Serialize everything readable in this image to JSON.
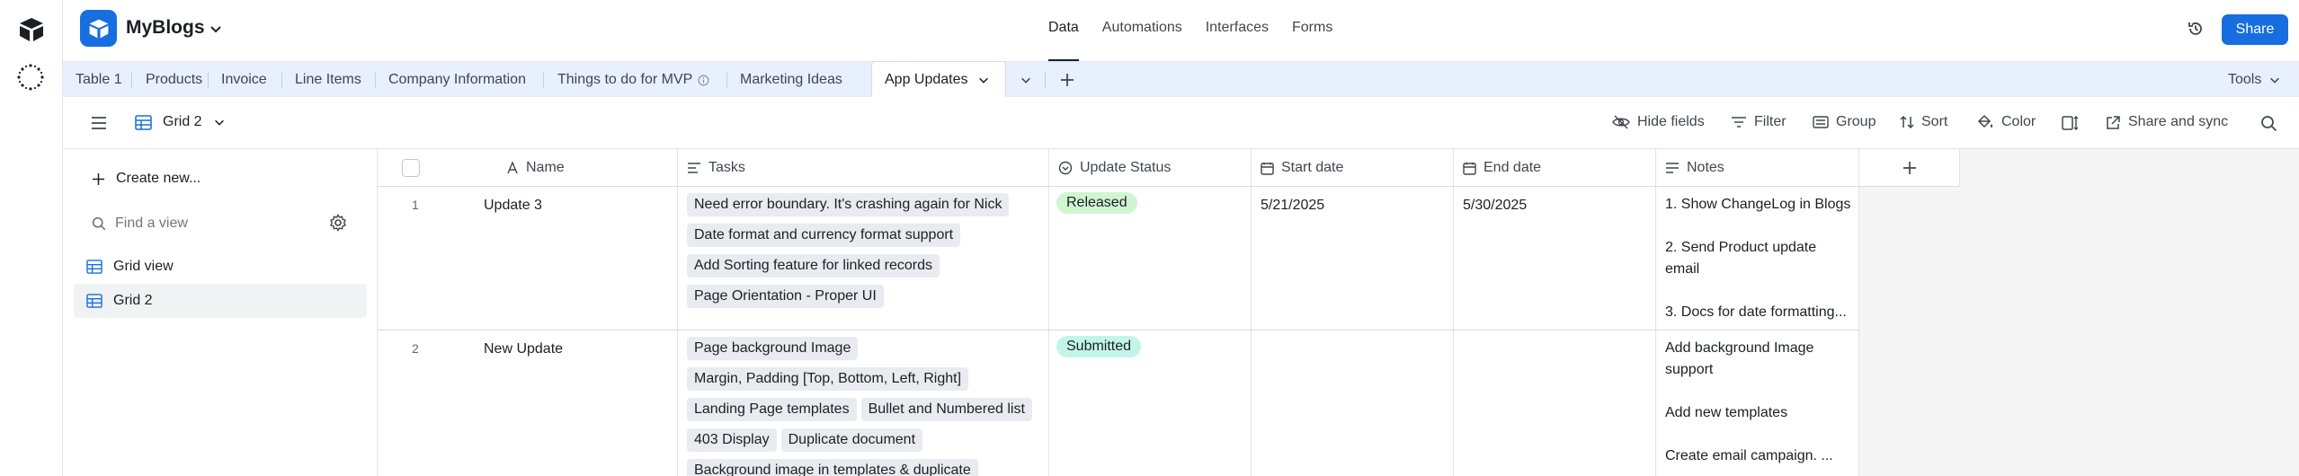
{
  "app": {
    "base_name": "MyBlogs",
    "nav": [
      {
        "label": "Data",
        "active": true
      },
      {
        "label": "Automations",
        "active": false
      },
      {
        "label": "Interfaces",
        "active": false
      },
      {
        "label": "Forms",
        "active": false
      }
    ],
    "share_label": "Share",
    "accent": "#166ee1"
  },
  "tabs": {
    "items": [
      "Table 1",
      "Products",
      "Invoice",
      "Line Items",
      "Company Information",
      "Things to do for MVP",
      "Marketing Ideas",
      "App Updates"
    ],
    "active": "App Updates",
    "tools_label": "Tools"
  },
  "viewbar": {
    "view_name": "Grid 2",
    "hide_fields": "Hide fields",
    "filter": "Filter",
    "group": "Group",
    "sort": "Sort",
    "color": "Color",
    "share_sync": "Share and sync"
  },
  "sidebar": {
    "create_new": "Create new...",
    "find_placeholder": "Find a view",
    "views": [
      {
        "label": "Grid view",
        "active": false
      },
      {
        "label": "Grid 2",
        "active": true
      }
    ]
  },
  "grid": {
    "columns": [
      "Name",
      "Tasks",
      "Update Status",
      "Start date",
      "End date",
      "Notes"
    ],
    "rows": [
      {
        "num": "1",
        "name": "Update 3",
        "tasks": [
          "Need error boundary. It's crashing again for Nick",
          "Date format and currency format support",
          "Add Sorting feature for linked records",
          "Page Orientation - Proper UI"
        ],
        "status": "Released",
        "status_color": "#cff5d1",
        "start": "5/21/2025",
        "end": "5/30/2025",
        "notes": [
          "1. Show ChangeLog in Blogs",
          "",
          "2. Send Product update",
          "email",
          "",
          "3. Docs for date formatting..."
        ]
      },
      {
        "num": "2",
        "name": "New Update",
        "tasks": [
          "Page background Image",
          "Margin, Padding [Top, Bottom, Left, Right]",
          "Landing Page templates",
          "Bullet and Numbered list",
          "403 Display",
          "Duplicate document",
          "Background image in templates & duplicate"
        ],
        "status": "Submitted",
        "status_color": "#c2f5e9",
        "start": "",
        "end": "",
        "notes": [
          "Add background Image",
          "support",
          "",
          "Add new templates",
          "",
          "Create email campaign. ..."
        ]
      }
    ]
  }
}
